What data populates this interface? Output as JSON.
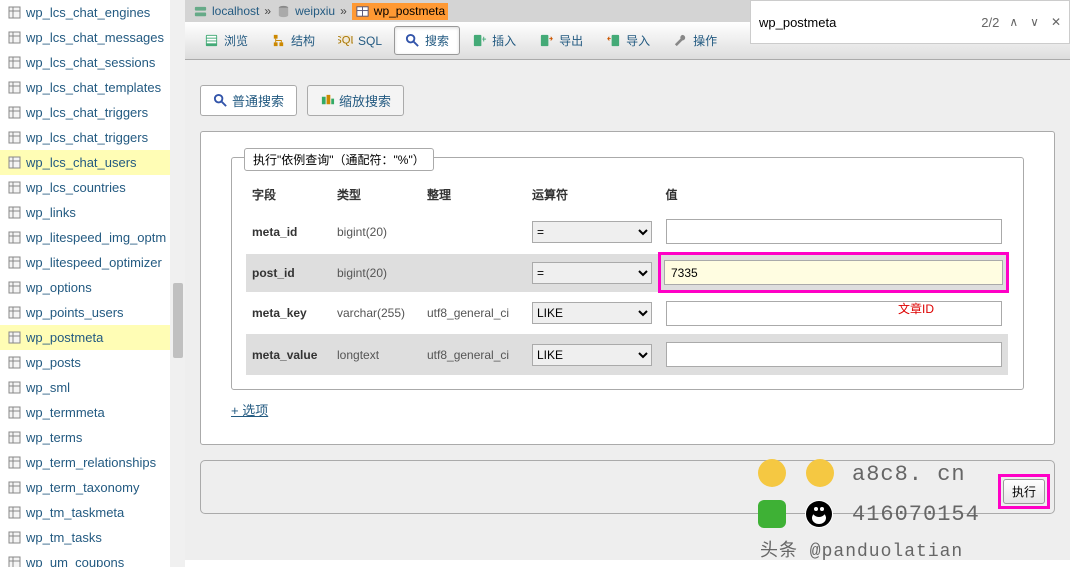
{
  "find": {
    "query": "wp_postmeta",
    "count": "2/2",
    "up_glyph": "∧",
    "down_glyph": "∨",
    "close_glyph": "✕"
  },
  "breadcrumb": {
    "server": "localhost",
    "database": "weipxiu",
    "table": "wp_postmeta",
    "sep": "»"
  },
  "sidebar": {
    "items": [
      {
        "label": "wp_lcs_chat_engines",
        "selected": false
      },
      {
        "label": "wp_lcs_chat_messages",
        "selected": false
      },
      {
        "label": "wp_lcs_chat_sessions",
        "selected": false
      },
      {
        "label": "wp_lcs_chat_templates",
        "selected": false
      },
      {
        "label": "wp_lcs_chat_triggers",
        "selected": false
      },
      {
        "label": "wp_lcs_chat_triggers",
        "selected": false
      },
      {
        "label": "wp_lcs_chat_users",
        "selected": true
      },
      {
        "label": "wp_lcs_countries",
        "selected": false
      },
      {
        "label": "wp_links",
        "selected": false
      },
      {
        "label": "wp_litespeed_img_optm",
        "selected": false
      },
      {
        "label": "wp_litespeed_optimizer",
        "selected": false
      },
      {
        "label": "wp_options",
        "selected": false
      },
      {
        "label": "wp_points_users",
        "selected": false
      },
      {
        "label": "wp_postmeta",
        "selected": true
      },
      {
        "label": "wp_posts",
        "selected": false
      },
      {
        "label": "wp_sml",
        "selected": false
      },
      {
        "label": "wp_termmeta",
        "selected": false
      },
      {
        "label": "wp_terms",
        "selected": false
      },
      {
        "label": "wp_term_relationships",
        "selected": false
      },
      {
        "label": "wp_term_taxonomy",
        "selected": false
      },
      {
        "label": "wp_tm_taskmeta",
        "selected": false
      },
      {
        "label": "wp_tm_tasks",
        "selected": false
      },
      {
        "label": "wp_um_coupons",
        "selected": false
      }
    ]
  },
  "toolbar": {
    "browse": "浏览",
    "structure": "结构",
    "sql": "SQL",
    "search": "搜索",
    "insert": "插入",
    "export": "导出",
    "import": "导入",
    "operations": "操作"
  },
  "searchTabs": {
    "normal": "普通搜索",
    "zoom": "缩放搜索"
  },
  "fieldset": {
    "legend": "执行\"依例查询\"（通配符：\"%\"）"
  },
  "columns": {
    "field": "字段",
    "type": "类型",
    "collation": "整理",
    "operator": "运算符",
    "value": "值"
  },
  "hints": {
    "post_id": "文章ID"
  },
  "rows": [
    {
      "field": "meta_id",
      "type": "bigint(20)",
      "collation": "",
      "operator": "=",
      "value": "",
      "striped": false,
      "highlighted": false
    },
    {
      "field": "post_id",
      "type": "bigint(20)",
      "collation": "",
      "operator": "=",
      "value": "7335",
      "striped": true,
      "highlighted": true
    },
    {
      "field": "meta_key",
      "type": "varchar(255)",
      "collation": "utf8_general_ci",
      "operator": "LIKE",
      "value": "",
      "striped": false,
      "highlighted": false
    },
    {
      "field": "meta_value",
      "type": "longtext",
      "collation": "utf8_general_ci",
      "operator": "LIKE",
      "value": "",
      "striped": true,
      "highlighted": false
    }
  ],
  "optionsLink": "+ 选项",
  "execButton": "执行",
  "watermarks": {
    "url": "a8c8. cn",
    "qq": "416070154",
    "toutiao": "头条 @panduolatian"
  }
}
